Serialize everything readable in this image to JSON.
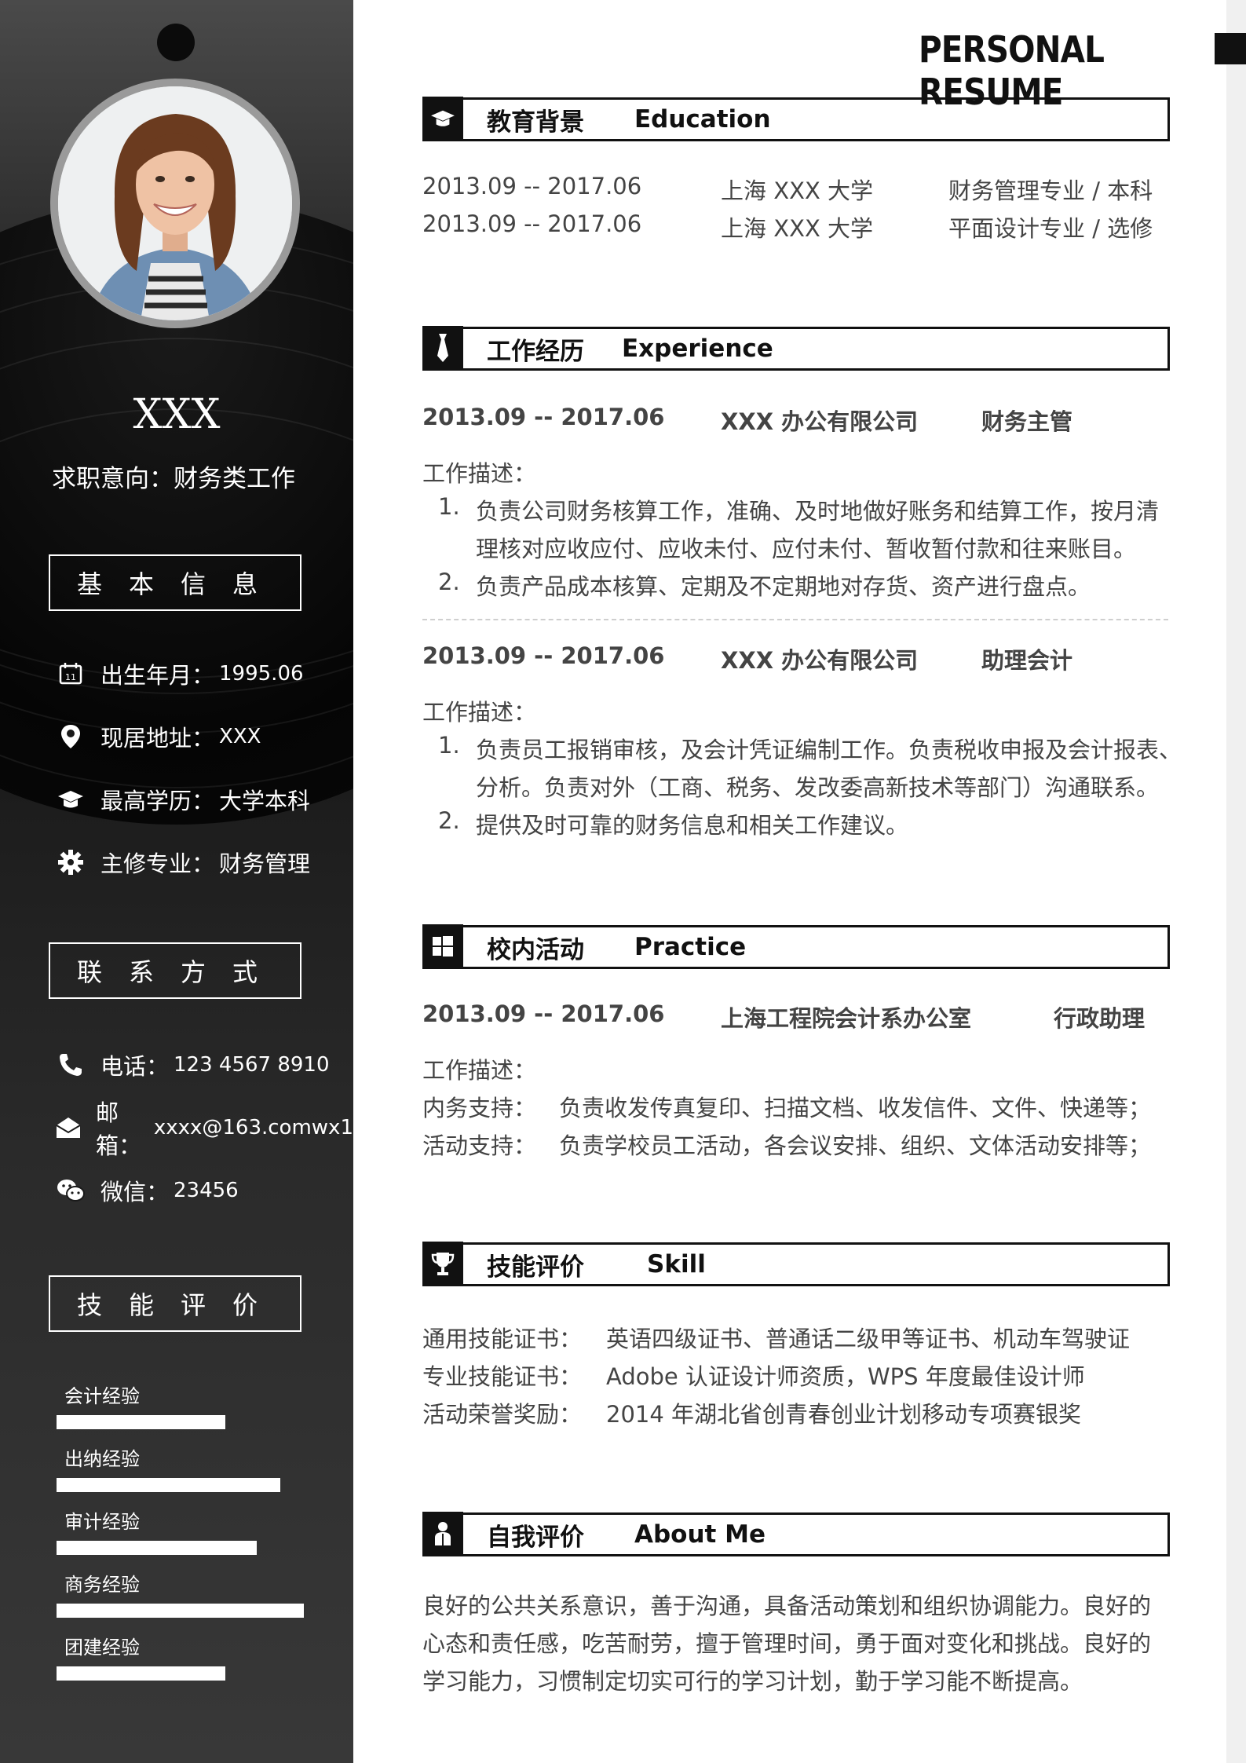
{
  "header": {
    "title": "PERSONAL RESUME"
  },
  "profile": {
    "name": "XXX",
    "intent": "求职意向：财务类工作"
  },
  "basic": {
    "heading": [
      "基",
      "本",
      "信",
      "息"
    ],
    "rows": [
      {
        "icon": "calendar-icon",
        "label": "出生年月：",
        "value": "1995.06"
      },
      {
        "icon": "location-pin-icon",
        "label": "现居地址：",
        "value": "XXX"
      },
      {
        "icon": "graduation-cap-icon",
        "label": "最高学历：",
        "value": "大学本科"
      },
      {
        "icon": "gear-icon",
        "label": "主修专业：",
        "value": "财务管理"
      }
    ]
  },
  "contact": {
    "heading": [
      "联",
      "系",
      "方",
      "式"
    ],
    "rows": [
      {
        "icon": "phone-icon",
        "label": "电话：",
        "value": "123 4567 8910"
      },
      {
        "icon": "mail-icon",
        "label": "邮箱：",
        "value": "xxxx@163.comwx1"
      },
      {
        "icon": "wechat-icon",
        "label": "微信：",
        "value": "23456"
      }
    ]
  },
  "skills_side": {
    "heading": [
      "技",
      "能",
      "评",
      "价"
    ],
    "items": [
      {
        "label": "会计经验",
        "level": 0.58
      },
      {
        "label": "出纳经验",
        "level": 0.77
      },
      {
        "label": "审计经验",
        "level": 0.69
      },
      {
        "label": "商务经验",
        "level": 0.85
      },
      {
        "label": "团建经验",
        "level": 0.58
      }
    ]
  },
  "education": {
    "cn": "教育背景",
    "en": "Education",
    "rows": [
      {
        "date": "2013.09 -- 2017.06",
        "school": "上海 XXX 大学",
        "major": "财务管理专业  /  本科"
      },
      {
        "date": "2013.09 -- 2017.06",
        "school": "上海 XXX 大学",
        "major": "平面设计专业  /  选修"
      }
    ]
  },
  "experience": {
    "cn": "工作经历",
    "en": "Experience",
    "jobs": [
      {
        "date": "2013.09 -- 2017.06",
        "company": "XXX 办公有限公司",
        "role": "财务主管",
        "desc_label": "工作描述：",
        "items": [
          {
            "num": "1.",
            "lines": [
              "负责公司财务核算工作，准确、及时地做好账务和结算工作，按月清",
              "理核对应收应付、应收未付、应付未付、暂收暂付款和往来账目。"
            ]
          },
          {
            "num": "2.",
            "lines": [
              "负责产品成本核算、定期及不定期地对存货、资产进行盘点。"
            ]
          }
        ]
      },
      {
        "date": "2013.09 -- 2017.06",
        "company": "XXX 办公有限公司",
        "role": "助理会计",
        "desc_label": "工作描述：",
        "items": [
          {
            "num": "1.",
            "lines": [
              "负责员工报销审核，及会计凭证编制工作。负责税收申报及会计报表、",
              "分析。负责对外（工商、税务、发改委高新技术等部门）沟通联系。"
            ]
          },
          {
            "num": "2.",
            "lines": [
              "提供及时可靠的财务信息和相关工作建议。"
            ]
          }
        ]
      }
    ]
  },
  "practice": {
    "cn": "校内活动",
    "en": "Practice",
    "date": "2013.09 -- 2017.06",
    "org": "上海工程院会计系办公室",
    "role": "行政助理",
    "desc_label": "工作描述：",
    "rows": [
      {
        "label": "内务支持：",
        "text": "负责收发传真复印、扫描文档、收发信件、文件、快递等；"
      },
      {
        "label": "活动支持：",
        "text": "负责学校员工活动，各会议安排、组织、文体活动安排等；"
      }
    ]
  },
  "skill": {
    "cn": "技能评价",
    "en": "Skill",
    "rows": [
      {
        "label": "通用技能证书：",
        "text": "英语四级证书、普通话二级甲等证书、机动车驾驶证"
      },
      {
        "label": "专业技能证书：",
        "text": "Adobe 认证设计师资质，WPS 年度最佳设计师"
      },
      {
        "label": "活动荣誉奖励：",
        "text": "2014 年湖北省创青春创业计划移动专项赛银奖"
      }
    ]
  },
  "about": {
    "cn": "自我评价",
    "en": "About Me",
    "lines": [
      "良好的公共关系意识，善于沟通，具备活动策划和组织协调能力。良好的",
      "心态和责任感，吃苦耐劳，擅于管理时间，勇于面对变化和挑战。良好的",
      "学习能力，习惯制定切实可行的学习计划，勤于学习能不断提高。"
    ]
  }
}
